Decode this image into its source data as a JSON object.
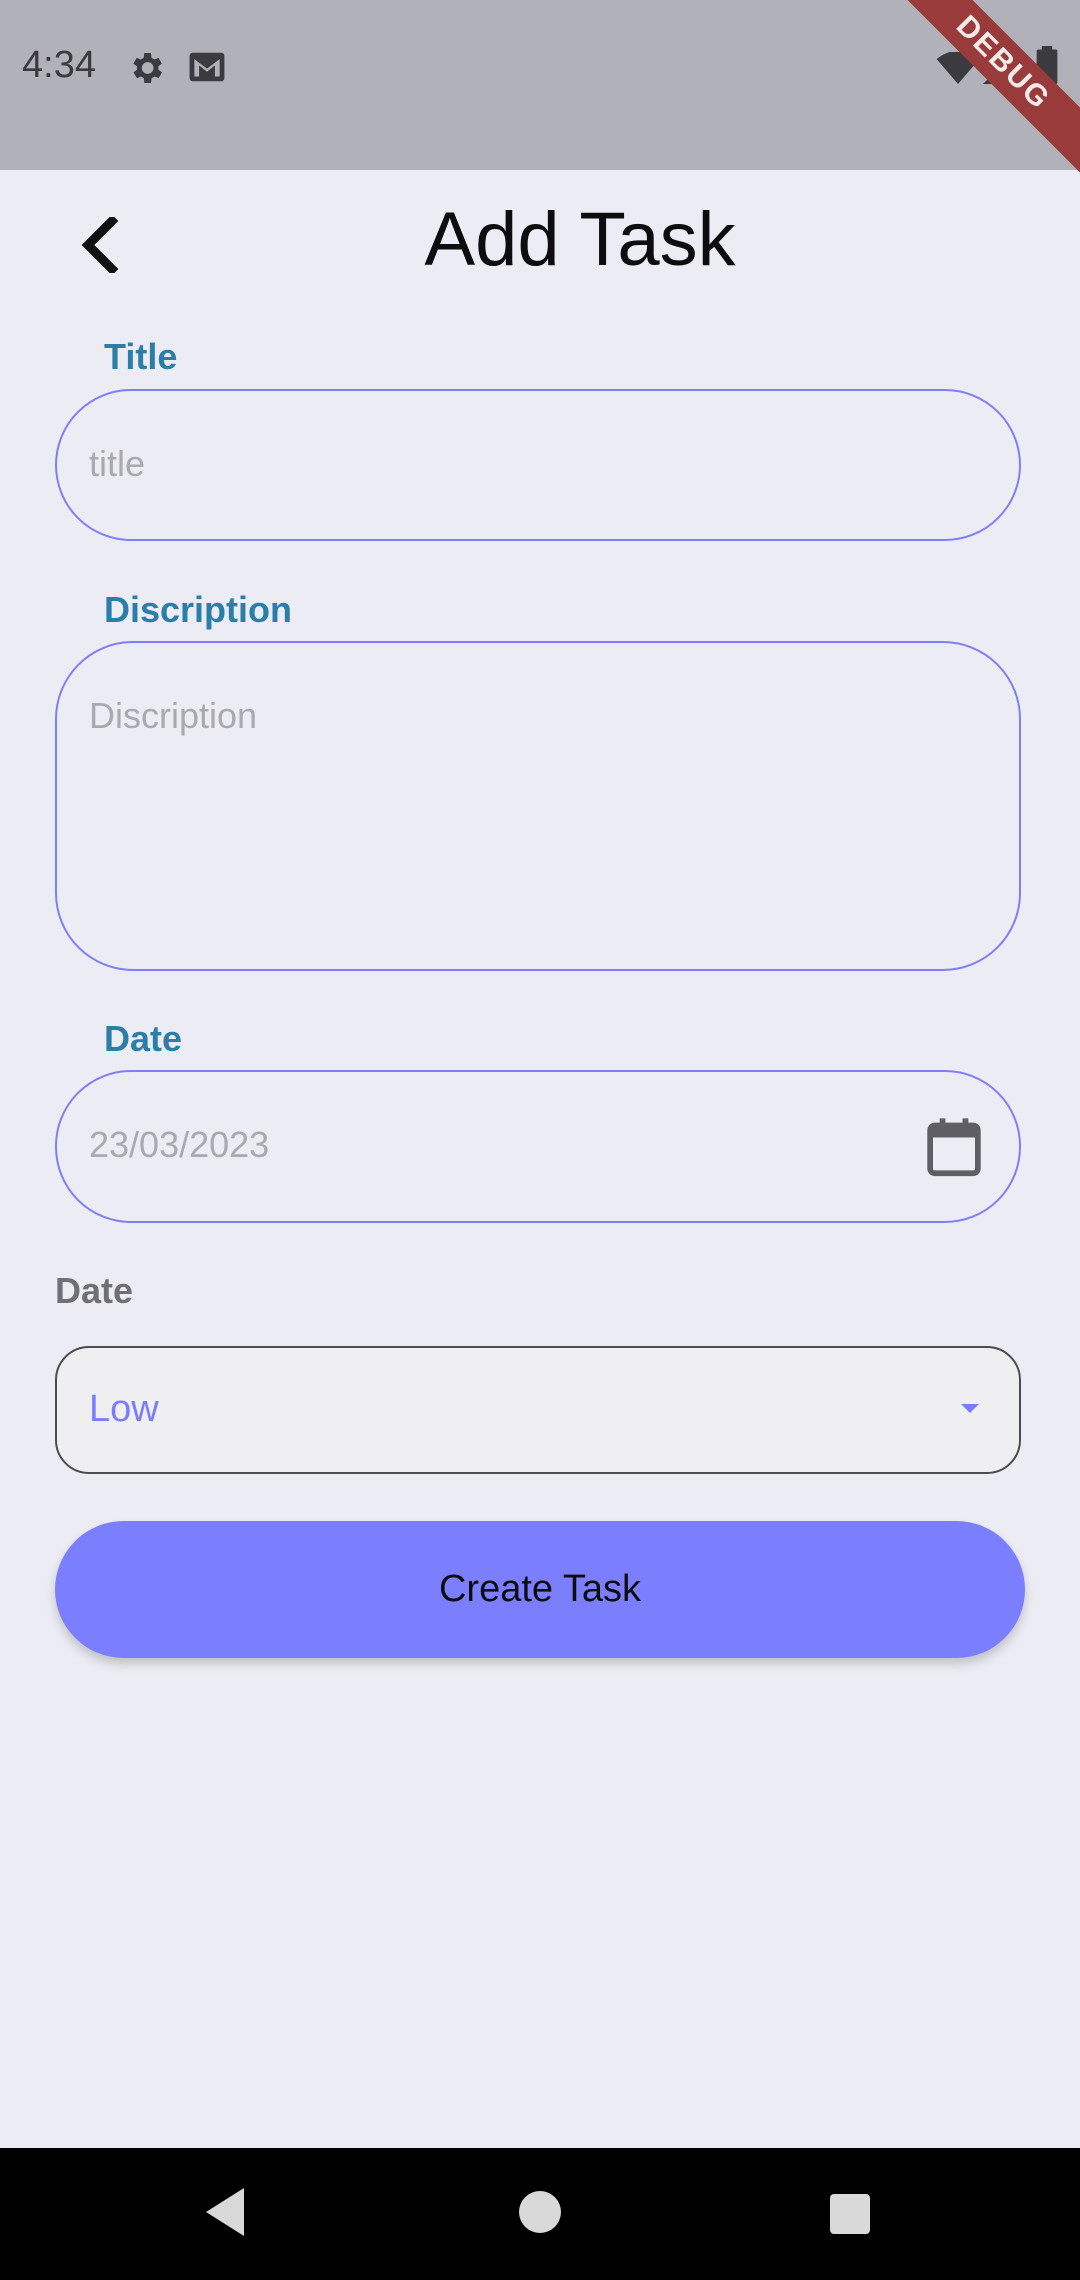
{
  "status_bar": {
    "time": "4:34",
    "icons": [
      "gear-icon",
      "gmail-icon",
      "wifi-icon",
      "signal-icon",
      "battery-icon"
    ],
    "debug_banner": "DEBUG"
  },
  "header": {
    "back_icon": "chevron-left-icon",
    "title": "Add Task"
  },
  "form": {
    "title_field": {
      "label": "Title",
      "placeholder": "title",
      "value": ""
    },
    "description_field": {
      "label": "Discription",
      "placeholder": "Discription",
      "value": ""
    },
    "date_field": {
      "label": "Date",
      "placeholder": "23/03/2023",
      "icon": "calendar-icon"
    },
    "priority_field": {
      "label": "Date",
      "selected": "Low"
    },
    "submit_label": "Create Task"
  },
  "nav_bar": {
    "icons": [
      "back-triangle-icon",
      "home-circle-icon",
      "recents-square-icon"
    ]
  },
  "colors": {
    "accent": "#7b7ffe",
    "label": "#2b7ea8",
    "background": "#ecedf4",
    "status_bar": "#b1b2b9"
  }
}
